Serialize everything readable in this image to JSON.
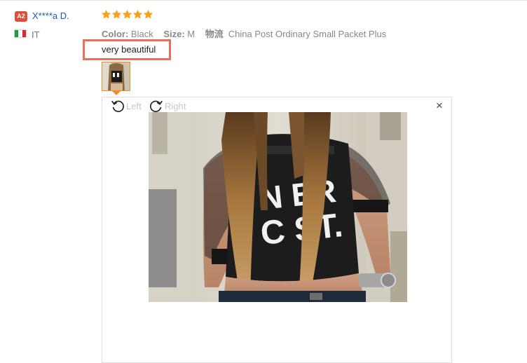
{
  "reviewer": {
    "level_badge": "A2",
    "name": "X****a D.",
    "country": "IT"
  },
  "review": {
    "rating": 5,
    "attributes": [
      {
        "key": "Color:",
        "value": "Black"
      },
      {
        "key": "Size:",
        "value": "M"
      }
    ],
    "shipping_key": "物流",
    "shipping_value": "China Post Ordinary Small Packet Plus",
    "feedback": "very beautiful"
  },
  "viewer": {
    "rotate_left_label": "Left",
    "rotate_right_label": "Right",
    "close_label": "×",
    "photo_text_top": "N  ER",
    "photo_text_bottom": "C   ST."
  },
  "colors": {
    "star": "#f7a21b",
    "highlight": "#e8705a",
    "link": "#1a5bb8",
    "thumb_border": "#f08a24"
  }
}
